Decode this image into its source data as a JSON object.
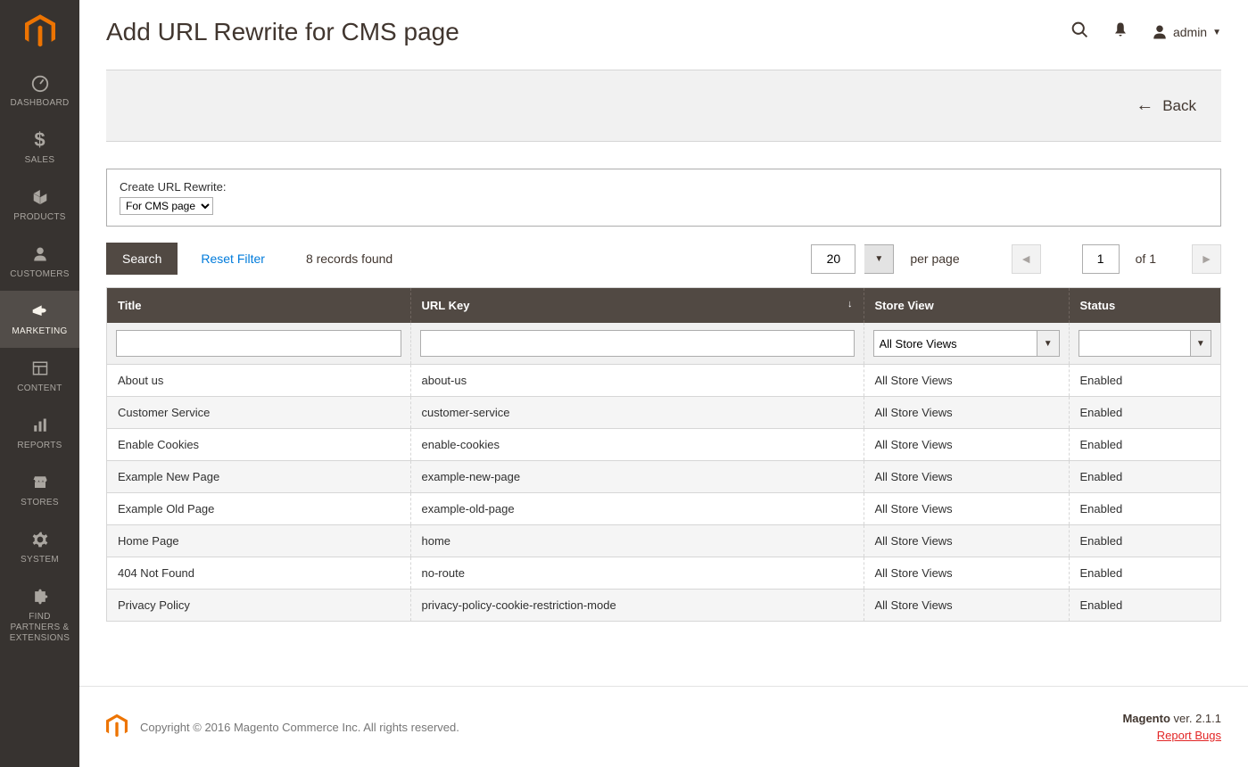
{
  "sidebar": {
    "items": [
      {
        "label": "DASHBOARD"
      },
      {
        "label": "SALES"
      },
      {
        "label": "PRODUCTS"
      },
      {
        "label": "CUSTOMERS"
      },
      {
        "label": "MARKETING"
      },
      {
        "label": "CONTENT"
      },
      {
        "label": "REPORTS"
      },
      {
        "label": "STORES"
      },
      {
        "label": "SYSTEM"
      },
      {
        "label": "FIND PARTNERS & EXTENSIONS"
      }
    ]
  },
  "header": {
    "title": "Add URL Rewrite for CMS page",
    "user": "admin"
  },
  "actionbar": {
    "back": "Back"
  },
  "create_box": {
    "label": "Create URL Rewrite:",
    "selected": "For CMS page"
  },
  "toolbar": {
    "search": "Search",
    "reset": "Reset Filter",
    "records_found": "8 records found",
    "per_page_value": "20",
    "per_page_label": "per page",
    "page_value": "1",
    "of_label": "of 1"
  },
  "grid": {
    "columns": {
      "title": "Title",
      "url_key": "URL Key",
      "store_view": "Store View",
      "status": "Status"
    },
    "filters": {
      "store_selected": "All Store Views"
    },
    "rows": [
      {
        "title": "About us",
        "url_key": "about-us",
        "store": "All Store Views",
        "status": "Enabled"
      },
      {
        "title": "Customer Service",
        "url_key": "customer-service",
        "store": "All Store Views",
        "status": "Enabled"
      },
      {
        "title": "Enable Cookies",
        "url_key": "enable-cookies",
        "store": "All Store Views",
        "status": "Enabled"
      },
      {
        "title": "Example New Page",
        "url_key": "example-new-page",
        "store": "All Store Views",
        "status": "Enabled"
      },
      {
        "title": "Example Old Page",
        "url_key": "example-old-page",
        "store": "All Store Views",
        "status": "Enabled"
      },
      {
        "title": "Home Page",
        "url_key": "home",
        "store": "All Store Views",
        "status": "Enabled"
      },
      {
        "title": "404 Not Found",
        "url_key": "no-route",
        "store": "All Store Views",
        "status": "Enabled"
      },
      {
        "title": "Privacy Policy",
        "url_key": "privacy-policy-cookie-restriction-mode",
        "store": "All Store Views",
        "status": "Enabled"
      }
    ]
  },
  "footer": {
    "copyright": "Copyright © 2016 Magento Commerce Inc. All rights reserved.",
    "magento_label": "Magento",
    "version": " ver. 2.1.1",
    "report_bugs": "Report Bugs"
  }
}
